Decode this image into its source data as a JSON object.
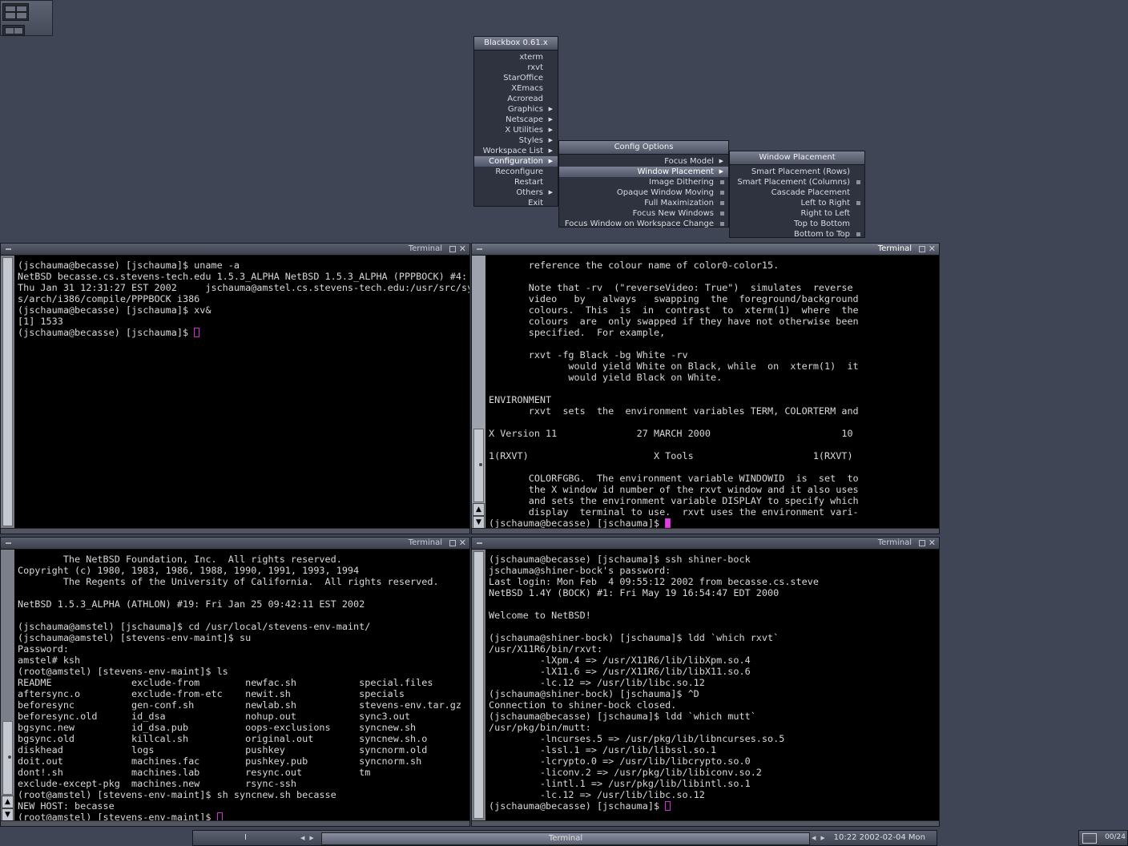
{
  "pager": {
    "label": "workspace pager"
  },
  "root_menu": {
    "title": "Blackbox 0.61.x",
    "items": [
      {
        "label": "xterm"
      },
      {
        "label": "rxvt"
      },
      {
        "label": "StarOffice"
      },
      {
        "label": "XEmacs"
      },
      {
        "label": "Acroread"
      },
      {
        "label": "Graphics",
        "sub": true
      },
      {
        "label": "Netscape",
        "sub": true
      },
      {
        "label": "X Utilities",
        "sub": true
      },
      {
        "label": "Styles",
        "sub": true
      },
      {
        "label": "Workspace List",
        "sub": true
      },
      {
        "label": "Configuration",
        "sub": true,
        "selected": true
      },
      {
        "label": "Reconfigure"
      },
      {
        "label": "Restart"
      },
      {
        "label": "Others",
        "sub": true
      },
      {
        "label": "Exit"
      }
    ]
  },
  "config_menu": {
    "title": "Config Options",
    "items": [
      {
        "label": "Focus Model",
        "sub": true
      },
      {
        "label": "Window Placement",
        "sub": true,
        "selected": true
      },
      {
        "label": "Image Dithering",
        "box": true
      },
      {
        "label": "Opaque Window Moving",
        "box": true
      },
      {
        "label": "Full Maximization",
        "box": true
      },
      {
        "label": "Focus New Windows",
        "box": true
      },
      {
        "label": "Focus Window on Workspace Change",
        "box": true
      }
    ]
  },
  "placement_menu": {
    "title": "Window Placement",
    "items": [
      {
        "label": "Smart Placement (Rows)"
      },
      {
        "label": "Smart Placement (Columns)",
        "box": true
      },
      {
        "label": "Cascade Placement"
      },
      {
        "label": "Left to Right",
        "box": true
      },
      {
        "label": "Right to Left"
      },
      {
        "label": "Top to Bottom"
      },
      {
        "label": "Bottom to Top",
        "box": true
      }
    ]
  },
  "terminals": {
    "tl": {
      "title": "Terminal",
      "text": "(jschauma@becasse) [jschauma]$ uname -a\nNetBSD becasse.cs.stevens-tech.edu 1.5.3_ALPHA NetBSD 1.5.3_ALPHA (PPPBOCK) #4:\nThu Jan 31 12:31:27 EST 2002     jschauma@amstel.cs.stevens-tech.edu:/usr/src/sy\ns/arch/i386/compile/PPPBOCK i386\n(jschauma@becasse) [jschauma]$ xv&\n[1] 1533\n(jschauma@becasse) [jschauma]$ "
    },
    "tr": {
      "title": "Terminal",
      "text": "       reference the colour name of color0-color15.\n\n       Note that -rv  (\"reverseVideo: True\")  simulates  reverse\n       video   by   always   swapping  the  foreground/background\n       colours.  This  is  in  contrast  to  xterm(1)  where  the\n       colours  are  only swapped if they have not otherwise been\n       specified.  For example,\n\n       rxvt -fg Black -bg White -rv\n              would yield White on Black, while  on  xterm(1)  it\n              would yield Black on White.\n\nENVIRONMENT\n       rxvt  sets  the  environment variables TERM, COLORTERM and\n\nX Version 11              27 MARCH 2000                       10\n\n1(RXVT)                      X Tools                     1(RXVT)\n\n       COLORFGBG.  The environment variable WINDOWID  is  set  to\n       the X window id number of the rxvt window and it also uses\n       and sets the environment variable DISPLAY to specify which\n       display  terminal to use.  rxvt uses the environment vari-\n(jschauma@becasse) [jschauma]$ "
    },
    "bl": {
      "title": "Terminal",
      "text": "        The NetBSD Foundation, Inc.  All rights reserved.\nCopyright (c) 1980, 1983, 1986, 1988, 1990, 1991, 1993, 1994\n        The Regents of the University of California.  All rights reserved.\n\nNetBSD 1.5.3_ALPHA (ATHLON) #19: Fri Jan 25 09:42:11 EST 2002\n\n(jschauma@amstel) [jschauma]$ cd /usr/local/stevens-env-maint/\n(jschauma@amstel) [stevens-env-maint]$ su\nPassword:\namstel# ksh\n(root@amstel) [stevens-env-maint]$ ls\nREADME              exclude-from        newfac.sh           special.files\naftersync.o         exclude-from-etc    newit.sh            specials\nbeforesync          gen-conf.sh         newlab.sh           stevens-env.tar.gz\nbeforesync.old      id_dsa              nohup.out           sync3.out\nbgsync.new          id_dsa.pub          oops-exclusions     syncnew.sh\nbgsync.old          killcal.sh          original.out        syncnew.sh.o\ndiskhead            logs                pushkey             syncnorm.old\ndoit.out            machines.fac        pushkey.pub         syncnorm.sh\ndont!.sh            machines.lab        resync.out          tm\nexclude-except-pkg  machines.new        rsync-ssh\n(root@amstel) [stevens-env-maint]$ sh syncnew.sh becasse\nNEW HOST: becasse\n(root@amstel) [stevens-env-maint]$ "
    },
    "br": {
      "title": "Terminal",
      "text": "(jschauma@becasse) [jschauma]$ ssh shiner-bock\njschauma@shiner-bock's password:\nLast login: Mon Feb  4 09:55:12 2002 from becasse.cs.steve\nNetBSD 1.4Y (BOCK) #1: Fri May 19 16:54:47 EDT 2000\n\nWelcome to NetBSD!\n\n(jschauma@shiner-bock) [jschauma]$ ldd `which rxvt`\n/usr/X11R6/bin/rxvt:\n         -lXpm.4 => /usr/X11R6/lib/libXpm.so.4\n         -lX11.6 => /usr/X11R6/lib/libX11.so.6\n         -lc.12 => /usr/lib/libc.so.12\n(jschauma@shiner-bock) [jschauma]$ ^D\nConnection to shiner-bock closed.\n(jschauma@becasse) [jschauma]$ ldd `which mutt`\n/usr/pkg/bin/mutt:\n         -lncurses.5 => /usr/pkg/lib/libncurses.so.5\n         -lssl.1 => /usr/lib/libssl.so.1\n         -lcrypto.0 => /usr/lib/libcrypto.so.0\n         -liconv.2 => /usr/pkg/lib/libiconv.so.2\n         -lintl.1 => /usr/pkg/lib/libintl.so.1\n         -lc.12 => /usr/lib/libc.so.12\n(jschauma@becasse) [jschauma]$ "
    }
  },
  "taskbar": {
    "workspace": "I",
    "task": "Terminal",
    "clock": "10:22 2002-02-04 Mon"
  },
  "slit": {
    "count": "00/24"
  }
}
